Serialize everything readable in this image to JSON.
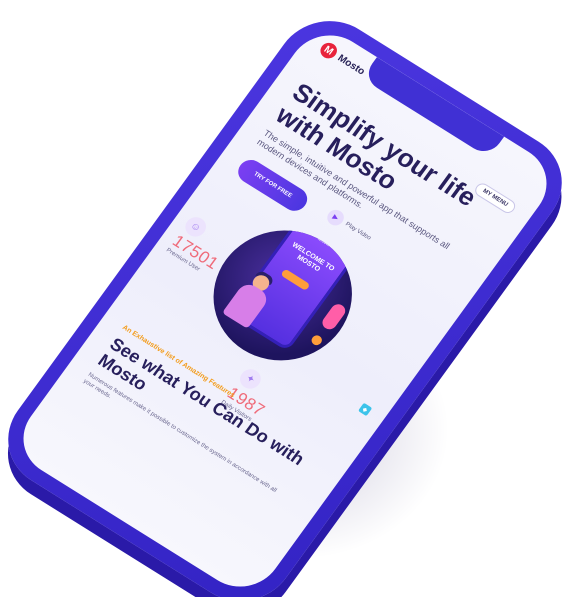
{
  "brand": {
    "logo_letter": "M",
    "name": "Mosto"
  },
  "nav": {
    "menu_label": "MY MENU"
  },
  "hero": {
    "title": "Simplify your life with Mosto",
    "subtitle": "The simple, intuitive and powerful app that supports all modern devices and platforms.",
    "cta_label": "TRY FOR FREE",
    "play_label": "Play Video"
  },
  "mockup": {
    "brand": "Mosto",
    "welcome": "WELCOME TO MOSTO"
  },
  "stats": [
    {
      "value": "17501",
      "label": "Premium User"
    },
    {
      "value": "1987",
      "label": "Daily Visitors"
    }
  ],
  "features": {
    "eyebrow": "An Exhaustive list of Amazing Features",
    "title": "See what You Can Do with Mosto",
    "text": "Numerous features make it possible to customize the system in accordance with all your needs."
  },
  "colors": {
    "frame": "#4b36e0",
    "accent": "#7b3ff2",
    "stat_number": "#ef6b7a",
    "eyebrow": "#f39c1b",
    "heading": "#271f5c"
  }
}
